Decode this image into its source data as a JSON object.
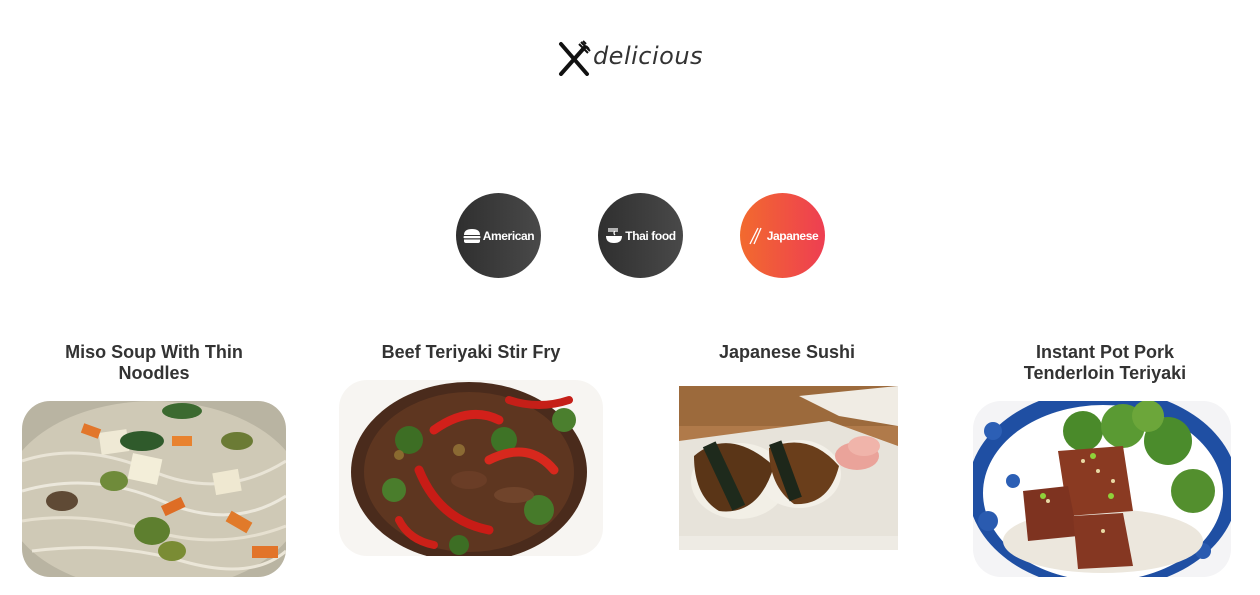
{
  "brand": {
    "name": "delicious",
    "icon": "utensils-icon"
  },
  "categories": [
    {
      "label": "American",
      "icon": "burger-icon",
      "active": false
    },
    {
      "label": "Thai food",
      "icon": "noodle-bowl-icon",
      "active": false
    },
    {
      "label": "Japanese",
      "icon": "chopsticks-icon",
      "active": true
    }
  ],
  "recipes": [
    {
      "title": "Miso Soup With Thin Noodles",
      "image": "miso-soup-photo"
    },
    {
      "title": "Beef Teriyaki Stir Fry",
      "image": "beef-stir-fry-photo"
    },
    {
      "title": "Japanese Sushi",
      "image": "sushi-photo"
    },
    {
      "title": "Instant Pot Pork Tenderloin Teriyaki",
      "image": "pork-teriyaki-photo"
    }
  ],
  "colors": {
    "active_gradient_start": "#f26a2e",
    "active_gradient_end": "#ee3e52",
    "inactive_gradient_start": "#2f2f2f",
    "inactive_gradient_end": "#494949",
    "text": "#333333"
  }
}
